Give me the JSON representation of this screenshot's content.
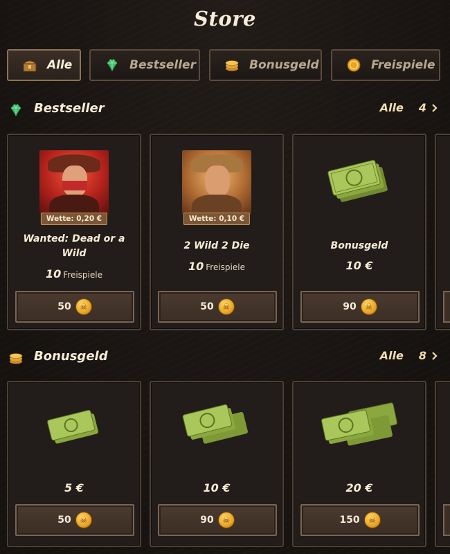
{
  "title": "Store",
  "tabs": [
    {
      "label": "Alle",
      "icon": "chest-icon",
      "active": true
    },
    {
      "label": "Bestseller",
      "icon": "gem-icon",
      "active": false
    },
    {
      "label": "Bonusgeld",
      "icon": "coins-stack-icon",
      "active": false
    },
    {
      "label": "Freispiele",
      "icon": "coin-icon",
      "active": false
    }
  ],
  "sections": [
    {
      "title": "Bestseller",
      "icon": "gem-icon",
      "all_label": "Alle",
      "count": "4",
      "cards": [
        {
          "kind": "game",
          "bet": "Wette: 0,20 €",
          "name": "Wanted: Dead or a Wild",
          "spins_count": "10",
          "spins_label": "Freispiele",
          "price": "50"
        },
        {
          "kind": "game",
          "bet": "Wette: 0,10 €",
          "name": "2 Wild 2 Die",
          "spins_count": "10",
          "spins_label": "Freispiele",
          "price": "50"
        },
        {
          "kind": "cash",
          "name": "Bonusgeld",
          "amount": "10 €",
          "price": "90"
        }
      ]
    },
    {
      "title": "Bonusgeld",
      "icon": "coins-stack-icon",
      "all_label": "Alle",
      "count": "8",
      "cards": [
        {
          "kind": "cash",
          "amount": "5 €",
          "price": "50"
        },
        {
          "kind": "cash",
          "amount": "10 €",
          "price": "90"
        },
        {
          "kind": "cash",
          "amount": "20 €",
          "price": "150"
        }
      ]
    }
  ],
  "colors": {
    "accent": "#f1dfae",
    "card_border": "#4e4035",
    "button": "#4b3a2f",
    "coin": "#e9a422",
    "cash": "#9bb94a"
  }
}
